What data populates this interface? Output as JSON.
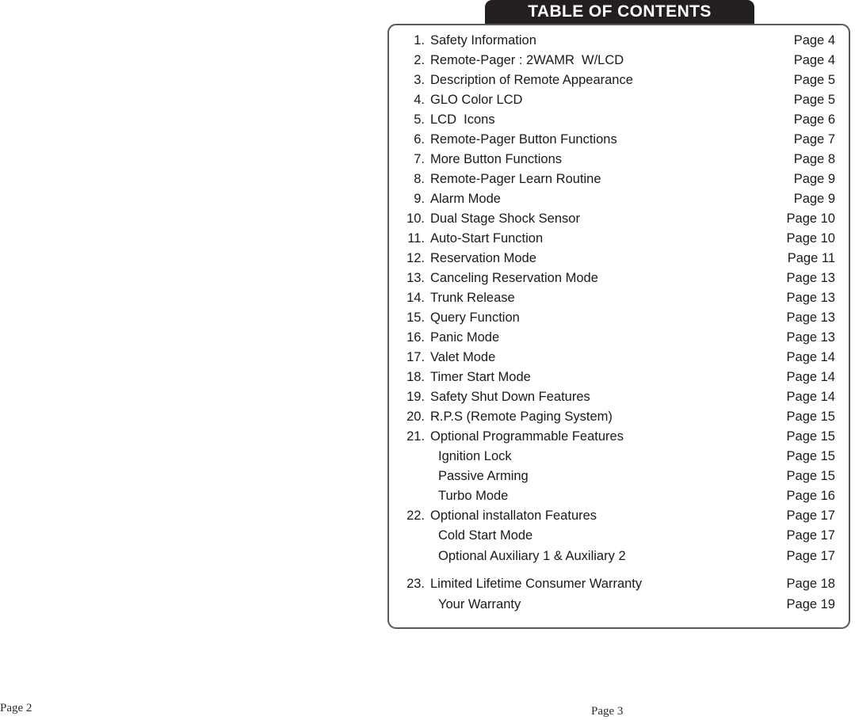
{
  "banner": {
    "title": "TABLE OF CONTENTS",
    "background_color": "#231f20",
    "text_color": "#ffffff"
  },
  "box": {
    "border_color": "#58595b"
  },
  "contents": {
    "rows": [
      {
        "num": "1.",
        "label": "Safety Information",
        "page": "Page 4",
        "sub": false,
        "gap": false
      },
      {
        "num": "2.",
        "label": "Remote-Pager : 2WAMR  W/LCD",
        "page": "Page 4",
        "sub": false,
        "gap": false
      },
      {
        "num": "3.",
        "label": "Description of Remote Appearance",
        "page": "Page 5",
        "sub": false,
        "gap": false
      },
      {
        "num": "4.",
        "label": "GLO Color LCD",
        "page": "Page 5",
        "sub": false,
        "gap": false
      },
      {
        "num": "5.",
        "label": "LCD  Icons",
        "page": "Page 6",
        "sub": false,
        "gap": false
      },
      {
        "num": "6.",
        "label": "Remote-Pager Button Functions",
        "page": "Page 7",
        "sub": false,
        "gap": false
      },
      {
        "num": "7.",
        "label": "More Button Functions",
        "page": "Page 8",
        "sub": false,
        "gap": false
      },
      {
        "num": "8.",
        "label": "Remote-Pager Learn Routine",
        "page": "Page 9",
        "sub": false,
        "gap": false
      },
      {
        "num": "9.",
        "label": "Alarm Mode",
        "page": "Page 9",
        "sub": false,
        "gap": false
      },
      {
        "num": "10.",
        "label": "Dual Stage Shock Sensor",
        "page": "Page 10",
        "sub": false,
        "gap": false
      },
      {
        "num": "11.",
        "label": "Auto-Start Function",
        "page": "Page 10",
        "sub": false,
        "gap": false
      },
      {
        "num": "12.",
        "label": "Reservation Mode",
        "page": "Page 11",
        "sub": false,
        "gap": false
      },
      {
        "num": "13.",
        "label": "Canceling Reservation Mode",
        "page": "Page 13",
        "sub": false,
        "gap": false
      },
      {
        "num": "14.",
        "label": "Trunk Release",
        "page": "Page 13",
        "sub": false,
        "gap": false
      },
      {
        "num": "15.",
        "label": "Query Function",
        "page": "Page 13",
        "sub": false,
        "gap": false
      },
      {
        "num": "16.",
        "label": "Panic Mode",
        "page": "Page 13",
        "sub": false,
        "gap": false
      },
      {
        "num": "17.",
        "label": "Valet Mode",
        "page": "Page 14",
        "sub": false,
        "gap": false
      },
      {
        "num": "18.",
        "label": "Timer Start Mode",
        "page": "Page 14",
        "sub": false,
        "gap": false
      },
      {
        "num": "19.",
        "label": "Safety Shut Down Features",
        "page": "Page 14",
        "sub": false,
        "gap": false
      },
      {
        "num": "20.",
        "label": "R.P.S (Remote Paging System)",
        "page": "Page 15",
        "sub": false,
        "gap": false
      },
      {
        "num": "21.",
        "label": "Optional Programmable Features",
        "page": "Page 15",
        "sub": false,
        "gap": false
      },
      {
        "num": "",
        "label": "Ignition Lock",
        "page": "Page 15",
        "sub": true,
        "gap": false
      },
      {
        "num": "",
        "label": "Passive Arming",
        "page": "Page 15",
        "sub": true,
        "gap": false
      },
      {
        "num": "",
        "label": "Turbo Mode",
        "page": "Page 16",
        "sub": true,
        "gap": false
      },
      {
        "num": "22.",
        "label": "Optional installaton Features",
        "page": "Page 17",
        "sub": false,
        "gap": false
      },
      {
        "num": "",
        "label": "Cold Start Mode",
        "page": "Page 17",
        "sub": true,
        "gap": false
      },
      {
        "num": "",
        "label": "Optional Auxiliary 1 & Auxiliary 2",
        "page": "Page 17",
        "sub": true,
        "gap": false
      },
      {
        "num": "23.",
        "label": "Limited Lifetime Consumer Warranty",
        "page": "Page 18",
        "sub": false,
        "gap": true
      },
      {
        "num": "",
        "label": "Your Warranty",
        "page": "Page 19",
        "sub": true,
        "gap": false
      }
    ]
  },
  "footers": {
    "left": "Page 2",
    "right": "Page 3"
  }
}
